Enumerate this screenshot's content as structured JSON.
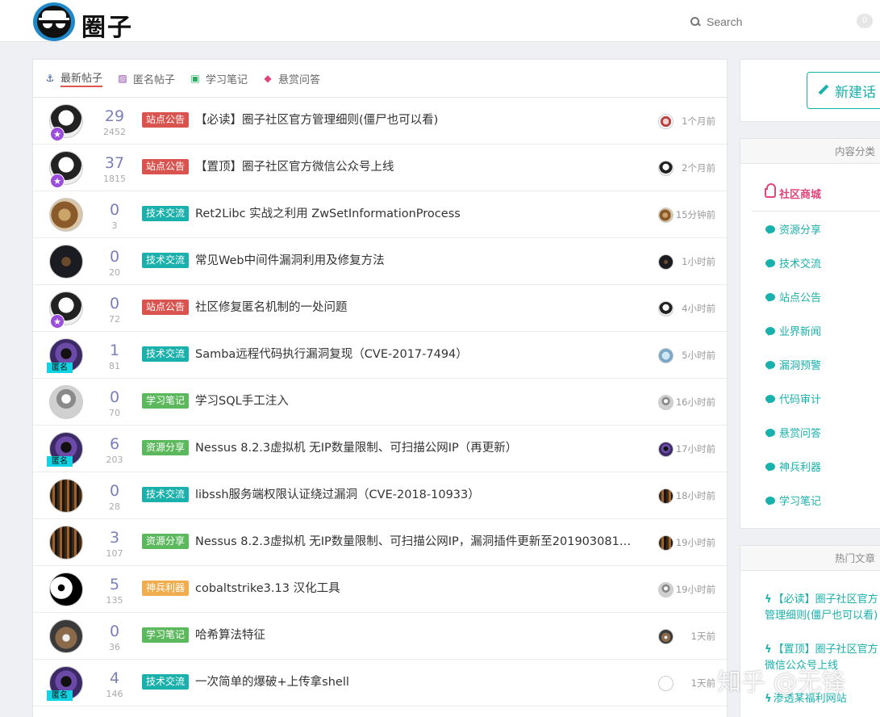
{
  "header": {
    "logo_text": "圈子",
    "search_placeholder": "Search",
    "notification_count": "0"
  },
  "tabs": [
    {
      "label": "最新帖子",
      "icon": "anchor-icon"
    },
    {
      "label": "匿名帖子",
      "icon": "stripes-icon"
    },
    {
      "label": "学习笔记",
      "icon": "calendar-check-icon"
    },
    {
      "label": "悬赏问答",
      "icon": "diamond-icon"
    }
  ],
  "posts": [
    {
      "replies": "29",
      "views": "2452",
      "tag": "站点公告",
      "title": "【必读】圈子社区官方管理细则(僵尸也可以看)",
      "time": "1个月前"
    },
    {
      "replies": "37",
      "views": "1815",
      "tag": "站点公告",
      "title": "【置顶】圈子社区官方微信公众号上线",
      "time": "2个月前"
    },
    {
      "replies": "0",
      "views": "3",
      "tag": "技术交流",
      "title": "Ret2Libc 实战之利用 ZwSetInformationProcess",
      "time": "15分钟前"
    },
    {
      "replies": "0",
      "views": "20",
      "tag": "技术交流",
      "title": "常见Web中间件漏洞利用及修复方法",
      "time": "1小时前"
    },
    {
      "replies": "0",
      "views": "72",
      "tag": "站点公告",
      "title": "社区修复匿名机制的一处问题",
      "time": "4小时前"
    },
    {
      "replies": "1",
      "views": "81",
      "tag": "技术交流",
      "title": "Samba远程代码执行漏洞复现（CVE-2017-7494）",
      "time": "5小时前",
      "badge": "匿名"
    },
    {
      "replies": "0",
      "views": "70",
      "tag": "学习笔记",
      "title": "学习SQL手工注入",
      "time": "16小时前"
    },
    {
      "replies": "6",
      "views": "203",
      "tag": "资源分享",
      "title": "Nessus 8.2.3虚拟机 无IP数量限制、可扫描公网IP（再更新）",
      "time": "17小时前",
      "badge": "匿名"
    },
    {
      "replies": "0",
      "views": "28",
      "tag": "技术交流",
      "title": "libssh服务端权限认证绕过漏洞（CVE-2018-10933）",
      "time": "18小时前"
    },
    {
      "replies": "3",
      "views": "107",
      "tag": "资源分享",
      "title": "Nessus 8.2.3虚拟机 无IP数量限制、可扫描公网IP，漏洞插件更新至201903081…",
      "time": "19小时前"
    },
    {
      "replies": "5",
      "views": "135",
      "tag": "神兵利器",
      "title": "cobaltstrike3.13 汉化工具",
      "time": "19小时前"
    },
    {
      "replies": "0",
      "views": "36",
      "tag": "学习笔记",
      "title": "哈希算法特征",
      "time": "1天前"
    },
    {
      "replies": "4",
      "views": "146",
      "tag": "技术交流",
      "title": "一次简单的爆破+上传拿shell",
      "time": "1天前",
      "badge": "匿名"
    }
  ],
  "sidebar": {
    "new_topic_label": "新建话",
    "category_header": "内容分类",
    "shop_label": "社区商城",
    "categories": [
      "资源分享",
      "技术交流",
      "站点公告",
      "业界新闻",
      "漏洞预警",
      "代码审计",
      "悬赏问答",
      "神兵利器",
      "学习笔记"
    ],
    "hot_header": "热门文章",
    "hot_articles": [
      "【必读】圈子社区官方管理细则(僵尸也可以看)",
      "【置顶】圈子社区官方微信公众号上线",
      "渗透某福利网站"
    ]
  },
  "watermark": "知乎 @无锋",
  "colors": {
    "accent": "#1ab0ab",
    "tag_announce": "#d9534f",
    "tag_tech": "#1ab0ab",
    "tag_green": "#5cb85c",
    "tag_tools": "#f0ad4e",
    "shop": "#e0457b",
    "reply_count": "#7b7fb8"
  }
}
